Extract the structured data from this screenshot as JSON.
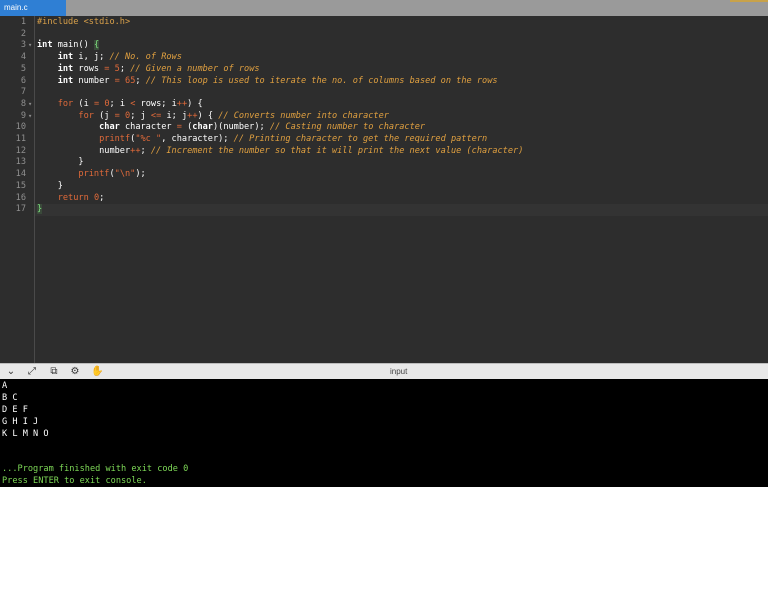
{
  "tab": {
    "title": "main.c"
  },
  "editor": {
    "line_numbers": [
      "1",
      "2",
      "3",
      "4",
      "5",
      "6",
      "7",
      "8",
      "9",
      "10",
      "11",
      "12",
      "13",
      "14",
      "15",
      "16",
      "17"
    ],
    "lines": {
      "l1_a": "#include ",
      "l1_b": "<stdio.h>",
      "l3_a": "int",
      "l3_b": " main() ",
      "l3_c": "{",
      "l4_a": "int",
      "l4_b": " i, j; ",
      "l4_c": "// No. of Rows",
      "l5_a": "int",
      "l5_b": " rows ",
      "l5_c": "=",
      "l5_d": " ",
      "l5_e": "5",
      "l5_f": "; ",
      "l5_g": "// Given a number of rows",
      "l6_a": "int",
      "l6_b": " number ",
      "l6_c": "=",
      "l6_d": " ",
      "l6_e": "65",
      "l6_f": "; ",
      "l6_g": "// This loop is used to iterate the no. of columns based on the rows",
      "l8_a": "for",
      "l8_b": " (i ",
      "l8_c": "=",
      "l8_d": " ",
      "l8_e": "0",
      "l8_f": "; i ",
      "l8_g": "<",
      "l8_h": " rows; i",
      "l8_i": "++",
      "l8_j": ") {",
      "l9_a": "for",
      "l9_b": " (j ",
      "l9_c": "=",
      "l9_d": " ",
      "l9_e": "0",
      "l9_f": "; j ",
      "l9_g": "<=",
      "l9_h": " i; j",
      "l9_i": "++",
      "l9_j": ") { ",
      "l9_k": "// Converts number into character",
      "l10_a": "char",
      "l10_b": " character ",
      "l10_c": "=",
      "l10_d": " (",
      "l10_e": "char",
      "l10_f": ")(number); ",
      "l10_g": "// Casting number to character",
      "l11_a": "printf",
      "l11_b": "(",
      "l11_c": "\"%c \"",
      "l11_d": ", character); ",
      "l11_e": "// Printing character to get the required pattern",
      "l12_a": "number",
      "l12_b": "++",
      "l12_c": "; ",
      "l12_d": "// Increment the number so that it will print the next value (character)",
      "l13_a": "}",
      "l14_a": "printf",
      "l14_b": "(",
      "l14_c": "\"\\n\"",
      "l14_d": ");",
      "l15_a": "}",
      "l16_a": "return",
      "l16_b": " ",
      "l16_c": "0",
      "l16_d": ";",
      "l17_a": "}"
    }
  },
  "console": {
    "label": "input",
    "output": [
      "A",
      "B C",
      "D E F",
      "G H I J",
      "K L M N O"
    ],
    "exit_message": "...Program finished with exit code 0",
    "prompt": "Press ENTER to exit console."
  },
  "icons": [
    "chevron-down-icon",
    "expand-icon",
    "copy-icon",
    "gear-icon",
    "stop-icon"
  ],
  "colors": {
    "tab_active": "#2f7fd4",
    "editor_bg": "#2d2d2d",
    "console_bg": "#000000",
    "console_green": "#7ed957"
  }
}
